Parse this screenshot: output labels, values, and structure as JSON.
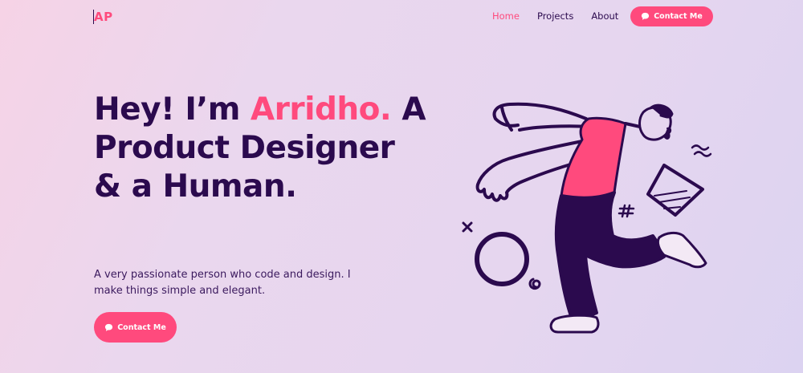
{
  "nav": {
    "logo": "AP",
    "links": [
      {
        "label": "Home",
        "active": true
      },
      {
        "label": "Projects",
        "active": false
      },
      {
        "label": "About",
        "active": false
      }
    ],
    "cta_label": "Contact Me",
    "cta_icon": "chat-bubble-icon"
  },
  "hero": {
    "greeting": "Hey! I’m",
    "name": "Arridho.",
    "title_rest": "A Product Designer & a Human.",
    "subtitle": "A very passionate person who code and design. I make things simple and elegant.",
    "cta_label": "Contact Me",
    "cta_icon": "chat-bubble-icon"
  },
  "illustration": {
    "icon": "dancing-person-illustration"
  },
  "colors": {
    "accent": "#ff4a7d",
    "text": "#2b0a4e",
    "background_start": "#f6d3e6",
    "background_end": "#dcd3f1"
  }
}
